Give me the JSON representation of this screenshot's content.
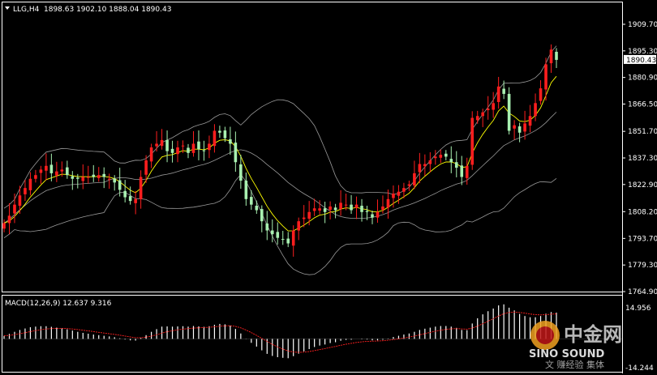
{
  "header": {
    "symbol": "LLG,H4",
    "ohlc": "1898.63 1902.10 1888.04 1890.43"
  },
  "macd_header": "MACD(12,26,9) 12.637 9.316",
  "colors": {
    "bull": "#ff1e1e",
    "bear": "#a8f0b0",
    "ma": "#ffff00",
    "bands": "#9a9a9a",
    "macd_bars": "#ffffff",
    "signal": "#ff2020",
    "grid": "#ffffff"
  },
  "watermark": {
    "cn": "中金网",
    "en": "SINO SOUND",
    "sub": "文 赚经验 集体"
  },
  "chart_data": [
    {
      "type": "candlestick",
      "title": "LLG,H4",
      "y_ticks": [
        "1909.70",
        "1895.30",
        "1880.90",
        "1866.50",
        "1851.70",
        "1837.30",
        "1822.90",
        "1808.20",
        "1793.70",
        "1779.30",
        "1764.90"
      ],
      "ylim": [
        1764.9,
        1909.7
      ],
      "last_price_label": "1890.43",
      "overlays": [
        "Bollinger Bands",
        "Moving Average"
      ],
      "close": [
        1802,
        1806,
        1812,
        1817,
        1821,
        1826,
        1828,
        1831,
        1833,
        1829,
        1830,
        1831,
        1828,
        1826,
        1826,
        1827,
        1827,
        1827,
        1828,
        1827,
        1826,
        1824,
        1820,
        1816,
        1814,
        1815,
        1827,
        1836,
        1843,
        1845,
        1847,
        1841,
        1840,
        1843,
        1844,
        1840,
        1845,
        1842,
        1841,
        1845,
        1852,
        1851,
        1848,
        1845,
        1835,
        1825,
        1815,
        1812,
        1809,
        1803,
        1798,
        1796,
        1794,
        1793,
        1791,
        1798,
        1803,
        1805,
        1808,
        1810,
        1810,
        1808,
        1811,
        1809,
        1813,
        1812,
        1809,
        1812,
        1808,
        1808,
        1805,
        1808,
        1811,
        1815,
        1818,
        1819,
        1821,
        1823,
        1829,
        1834,
        1834,
        1836,
        1838,
        1839,
        1838,
        1835,
        1832,
        1827,
        1833,
        1859,
        1860,
        1862,
        1864,
        1867,
        1876,
        1872,
        1852,
        1855,
        1851,
        1856,
        1860,
        1867,
        1875,
        1888,
        1896,
        1890.43
      ],
      "macd": [
        1.5,
        2.4,
        3.4,
        4.3,
        5.0,
        5.6,
        5.9,
        6.1,
        6.1,
        5.8,
        5.4,
        5.1,
        4.6,
        4.0,
        3.4,
        2.9,
        2.5,
        2.1,
        1.8,
        1.5,
        1.2,
        0.8,
        0.3,
        -0.3,
        -0.7,
        -0.8,
        0.4,
        1.8,
        3.4,
        4.7,
        5.9,
        6.0,
        5.9,
        6.0,
        6.1,
        5.9,
        6.2,
        6.0,
        5.8,
        6.1,
        6.8,
        7.2,
        7.0,
        6.4,
        4.8,
        2.6,
        0.1,
        -1.9,
        -3.7,
        -5.5,
        -7.2,
        -8.2,
        -8.8,
        -9.1,
        -9.3,
        -8.3,
        -7.1,
        -6.0,
        -4.9,
        -3.9,
        -3.2,
        -2.7,
        -2.0,
        -1.6,
        -0.9,
        -0.5,
        -0.4,
        0.0,
        -0.2,
        -0.3,
        -0.7,
        -0.7,
        -0.4,
        0.2,
        0.9,
        1.5,
        2.1,
        2.6,
        3.4,
        4.3,
        4.9,
        5.4,
        5.9,
        6.2,
        6.2,
        5.9,
        5.3,
        4.3,
        4.2,
        7.4,
        9.9,
        11.8,
        13.3,
        14.6,
        16.1,
        16.6,
        15.0,
        13.7,
        12.0,
        11.0,
        10.4,
        10.4,
        11.0,
        12.1,
        12.9,
        12.637
      ],
      "macd_ylim": [
        -14.244,
        14.956
      ],
      "macd_ticks": [
        "14.956",
        "-14.244"
      ]
    }
  ]
}
